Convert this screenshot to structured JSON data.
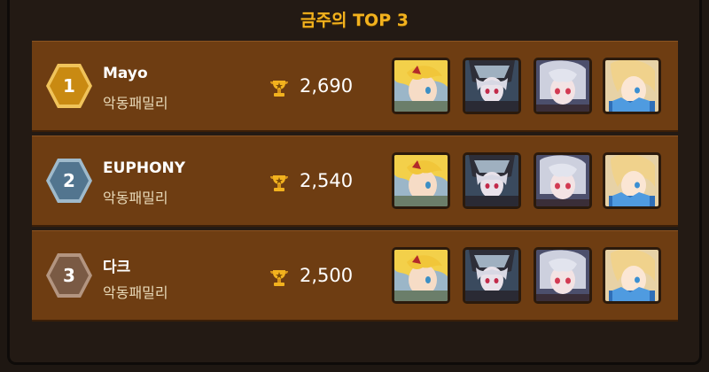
{
  "title": "금주의 TOP 3",
  "entries": [
    {
      "rank": "1",
      "name": "Mayo",
      "guild": "악동패밀리",
      "score": "2,690",
      "badge_color": "#d89a1c",
      "badge_inner": "#b87a0a",
      "portraits": [
        "blonde-hero-portrait",
        "dark-knight-portrait",
        "silver-hair-girl-portrait",
        "blonde-mage-portrait"
      ]
    },
    {
      "rank": "2",
      "name": "EUPHONY",
      "guild": "악동패밀리",
      "score": "2,540",
      "badge_color": "#6b8ea8",
      "badge_inner": "#4f7088",
      "portraits": [
        "blonde-hero-portrait",
        "dark-knight-portrait",
        "silver-hair-girl-portrait",
        "blonde-mage-portrait"
      ]
    },
    {
      "rank": "3",
      "name": "다크",
      "guild": "악동패밀리",
      "score": "2,500",
      "badge_color": "#8a6a52",
      "badge_inner": "#6b4e3a",
      "portraits": [
        "blonde-hero-portrait",
        "dark-knight-portrait",
        "silver-hair-girl-portrait",
        "blonde-mage-portrait"
      ]
    }
  ],
  "icons": {
    "score": "trophy-icon"
  },
  "colors": {
    "title": "#f2b21e",
    "row_bg": "#6e3d12",
    "frame_bg": "#231a14"
  }
}
